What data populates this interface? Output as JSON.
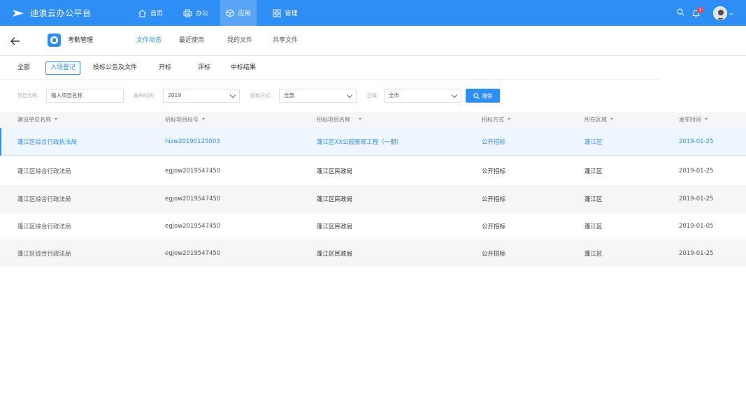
{
  "app": {
    "brand_title": "迪浪云办公平台",
    "nav": [
      {
        "label": "首页",
        "icon": "home-icon"
      },
      {
        "label": "办公",
        "icon": "printer-icon"
      },
      {
        "label": "应用",
        "icon": "cube-icon"
      },
      {
        "label": "管理",
        "icon": "grid-icon"
      }
    ],
    "active_nav": "应用",
    "notification_count": "2"
  },
  "subheader": {
    "app_name": "考勤管理",
    "tabs": [
      "文件动态",
      "最近使用",
      "我的文件",
      "共享文件"
    ],
    "active_tab": "文件动态"
  },
  "categories": {
    "items": [
      "全部",
      "入场登记",
      "投标公告及文件",
      "开标",
      "评标",
      "中标结果"
    ],
    "active": "入场登记"
  },
  "filters": {
    "project_name_label": "项目名称:",
    "project_name_placeholder": "输入项目名称",
    "publish_time_label": "发布时间:",
    "publish_time_value": "2019",
    "bid_method_label": "招标方式:",
    "bid_method_value": "全部",
    "region_label": "区域:",
    "region_value": "全市",
    "search_label": "搜索"
  },
  "table": {
    "columns": [
      "建设单位名称",
      "招标项目标号",
      "招标项目名称",
      "招标方式",
      "所在区域",
      "发布时间"
    ],
    "rows": [
      [
        "蓬江区综合行政执法局",
        "hizw20190125003",
        "蓬江区XX公园景观工程（一期）",
        "公开招标",
        "蓬江区",
        "2019-01-25"
      ],
      [
        "蓬江区综合行政法局",
        "egjow2019547450",
        "蓬江区民政局",
        "公开招标",
        "蓬江区",
        "2019-01-25"
      ],
      [
        "蓬江区综合行政法局",
        "egjow2019547450",
        "蓬江区民政局",
        "公开招标",
        "蓬江区",
        "2019-01-25"
      ],
      [
        "蓬江区综合行政法局",
        "egjow2019547450",
        "蓬江区民政局",
        "公开招标",
        "蓬江区",
        "2019-01-05"
      ],
      [
        "蓬江区综合行政法局",
        "egjow2019547450",
        "蓬江区民政局",
        "公开招标",
        "蓬江区",
        "2019-01-25"
      ]
    ],
    "selected_row": 0
  },
  "colors": {
    "primary": "#2f8ef4",
    "active_nav_bg": "#5aa5f6",
    "badge": "#f04848",
    "stripe": "#f6f6f6"
  }
}
